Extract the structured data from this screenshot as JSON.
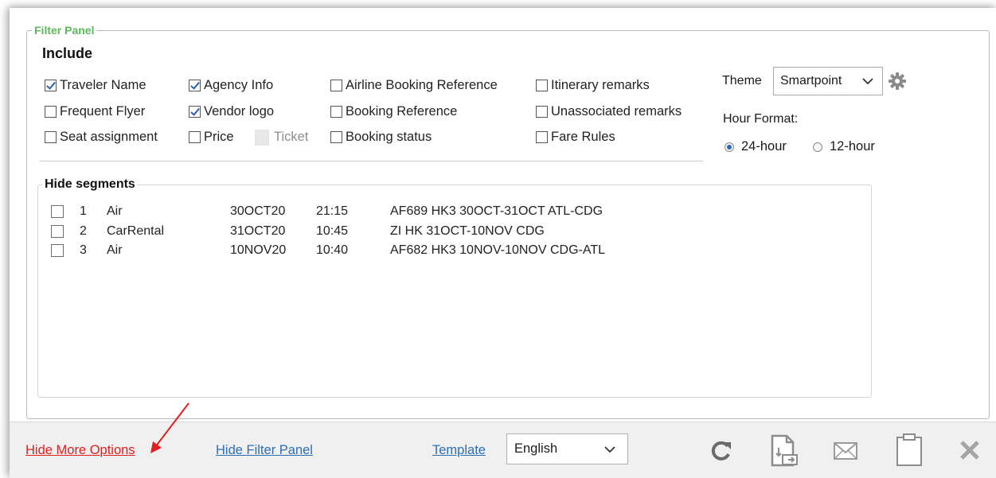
{
  "filter_panel": {
    "legend": "Filter Panel",
    "include_title": "Include",
    "options": [
      {
        "label": "Traveler Name",
        "checked": true
      },
      {
        "label": "Agency Info",
        "checked": true
      },
      {
        "label": "Airline Booking Reference",
        "checked": false
      },
      {
        "label": "Itinerary remarks",
        "checked": false
      },
      {
        "label": "Frequent Flyer",
        "checked": false
      },
      {
        "label": "Vendor logo",
        "checked": true
      },
      {
        "label": "Booking Reference",
        "checked": false
      },
      {
        "label": "Unassociated remarks",
        "checked": false
      },
      {
        "label": "Seat assignment",
        "checked": false
      },
      {
        "label": "Price",
        "checked": false
      },
      {
        "label": "Booking status",
        "checked": false
      },
      {
        "label": "Fare Rules",
        "checked": false
      }
    ],
    "ticket_label": "Ticket",
    "theme": {
      "label": "Theme",
      "selected": "Smartpoint"
    },
    "hour_format": {
      "label": "Hour Format:",
      "options": [
        "24-hour",
        "12-hour"
      ],
      "selected": "24-hour"
    }
  },
  "segments": {
    "legend": "Hide segments",
    "rows": [
      {
        "num": "1",
        "type": "Air",
        "date": "30OCT20",
        "time": "21:15",
        "desc": "AF689 HK3 30OCT-31OCT ATL-CDG",
        "checked": false
      },
      {
        "num": "2",
        "type": "CarRental",
        "date": "31OCT20",
        "time": "10:45",
        "desc": "ZI HK 31OCT-10NOV CDG",
        "checked": false
      },
      {
        "num": "3",
        "type": "Air",
        "date": "10NOV20",
        "time": "10:40",
        "desc": "AF682 HK3 10NOV-10NOV CDG-ATL",
        "checked": false
      }
    ]
  },
  "footer": {
    "hide_more_options": "Hide More Options",
    "hide_filter_panel": "Hide Filter Panel",
    "template": "Template",
    "language": "English",
    "icons": [
      "refresh-icon",
      "document-export-icon",
      "email-icon",
      "clipboard-icon",
      "close-icon"
    ]
  },
  "colors": {
    "legend_green": "#5cb85c",
    "link_red": "#e02020",
    "link_blue": "#2f6db5",
    "annotation_arrow": "#e02020",
    "icon_gray": "#9a9a9a"
  }
}
